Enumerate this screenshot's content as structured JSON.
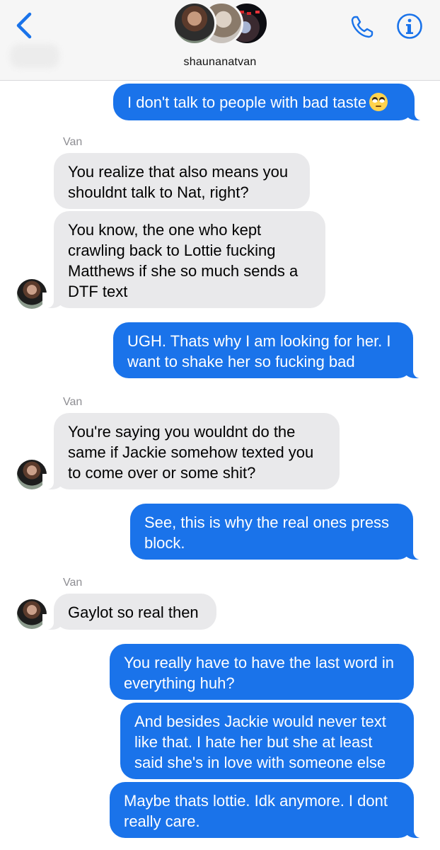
{
  "header": {
    "group_name": "shaunanatvan",
    "icons": {
      "back": "chevron-left-icon",
      "phone": "phone-icon",
      "info": "info-icon"
    }
  },
  "accent_color": "#1a73ea",
  "incoming_color": "#e9e9eb",
  "messages": [
    {
      "sender": "",
      "text": "I don't talk to people with bad taste",
      "emoji": "eye-roll-emoji"
    },
    {
      "sender": "Van",
      "text": "You realize that also means you\nshouldnt talk to Nat, right?"
    },
    {
      "sender": "",
      "text": "You know, the one who kept\ncrawling back to Lottie fucking\nMatthews if she so much sends a\nDTF text"
    },
    {
      "sender": "",
      "text": "UGH. Thats why I am looking for her. I\nwant to shake her so fucking bad"
    },
    {
      "sender": "Van",
      "text": "You're saying you wouldnt do the\nsame if Jackie somehow texted you\nto come over or some shit?"
    },
    {
      "sender": "",
      "text": "See, this is why the real ones press\nblock."
    },
    {
      "sender": "Van",
      "text": "Gaylot so real then"
    },
    {
      "sender": "",
      "text": "You really have to have the last word in\neverything huh?"
    },
    {
      "sender": "",
      "text": "And besides Jackie would never text\nlike that. I hate her but she at least\nsaid she's in love with someone else"
    },
    {
      "sender": "",
      "text": "Maybe thats lottie. Idk anymore. I dont\nreally care."
    }
  ]
}
